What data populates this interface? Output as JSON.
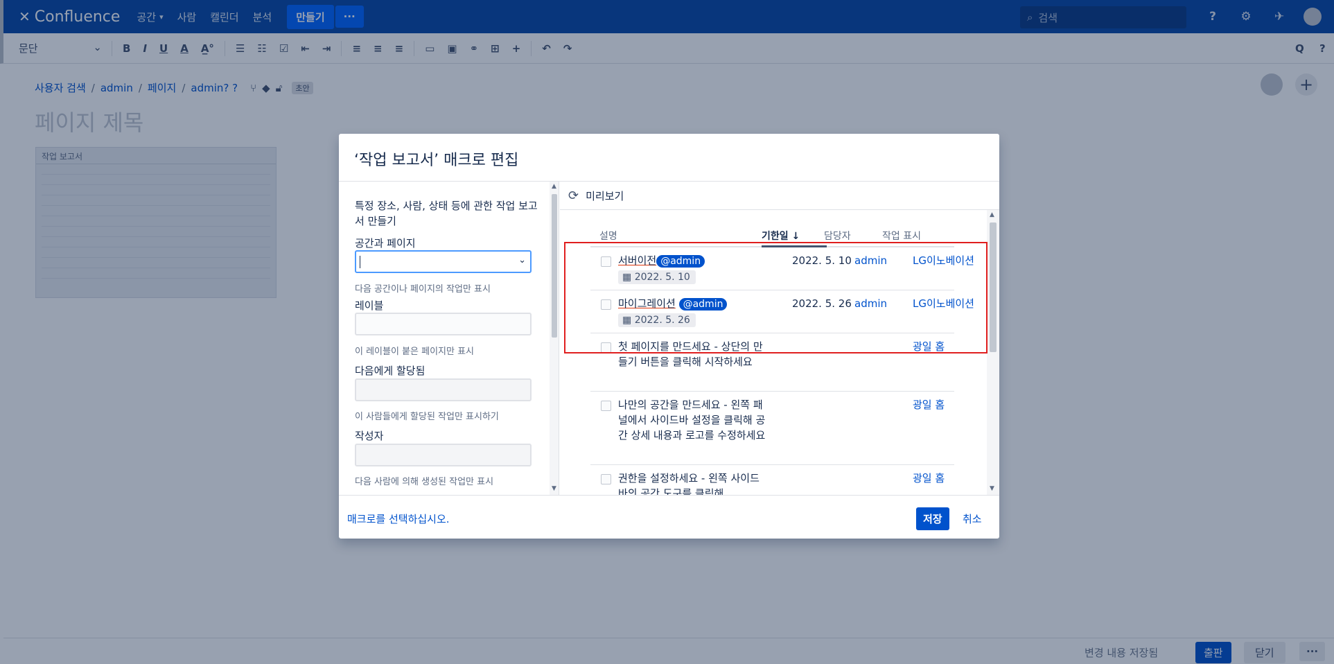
{
  "nav": {
    "logo": "Confluence",
    "items": [
      "공간",
      "사람",
      "캘린더",
      "분석"
    ],
    "create": "만들기",
    "more": "···",
    "search_placeholder": "검색"
  },
  "toolbar": {
    "paragraph": "문단",
    "bold": "B",
    "italic": "I",
    "underline": "U",
    "text_color": "A",
    "undo": "↶",
    "redo": "↷",
    "find": "Q",
    "help": "?"
  },
  "page": {
    "breadcrumb": [
      "사용자 검색",
      "admin",
      "페이지",
      "admin? ?"
    ],
    "draft_badge": "초안",
    "title_placeholder": "페이지 제목",
    "thumbnail_title": "작업 보고서"
  },
  "dialog": {
    "title": "‘작업 보고서’ 매크로 편집",
    "intro": "특정 장소, 사람, 상태 등에 관한 작업 보고서 만들기",
    "fields": [
      {
        "label": "공간과 페이지",
        "help": "다음 공간이나 페이지의 작업만 표시"
      },
      {
        "label": "레이블",
        "help": "이 레이블이 붙은 페이지만 표시"
      },
      {
        "label": "다음에게 할당됨",
        "help": "이 사람들에게 할당된 작업만 표시하기"
      },
      {
        "label": "작성자",
        "help": "다음 사람에 의해 생성된 작업만 표시"
      }
    ],
    "preview_title": "미리보기",
    "columns": {
      "description": "설명",
      "due": "기한일",
      "assignee": "담당자",
      "location": "작업 표시"
    },
    "rows": [
      {
        "text": "서버이전",
        "mention": "@admin",
        "date_chip": "2022. 5. 10",
        "due": "2022. 5. 10",
        "assignee": "admin",
        "location": "LG이노베이션"
      },
      {
        "text": "마이그레이션",
        "mention": "@admin",
        "date_chip": "2022. 5. 26",
        "due": "2022. 5. 26",
        "assignee": "admin",
        "location": "LG이노베이션"
      },
      {
        "text": "첫 페이지를 만드세요 - 상단의 만들기 버튼을 클릭해 시작하세요",
        "location": "광일 홈"
      },
      {
        "text": "나만의 공간을 만드세요 - 왼쪽 패널에서 사이드바 설정을 클릭해 공간 상세 내용과 로고를 수정하세요",
        "location": "광일 홈"
      },
      {
        "text": "권한을 설정하세요 - 왼쪽 사이드바의 공간 도구를 클릭해",
        "location": "광일 홈"
      }
    ],
    "footer_link": "매크로를 선택하십시오.",
    "save": "저장",
    "cancel": "취소"
  },
  "footer": {
    "saved": "변경 내용 저장됨",
    "publish": "출판",
    "close": "닫기",
    "more": "···"
  },
  "colors": {
    "nav": "#0747a6",
    "accent": "#0052cc",
    "highlight": "#e01e1e"
  }
}
